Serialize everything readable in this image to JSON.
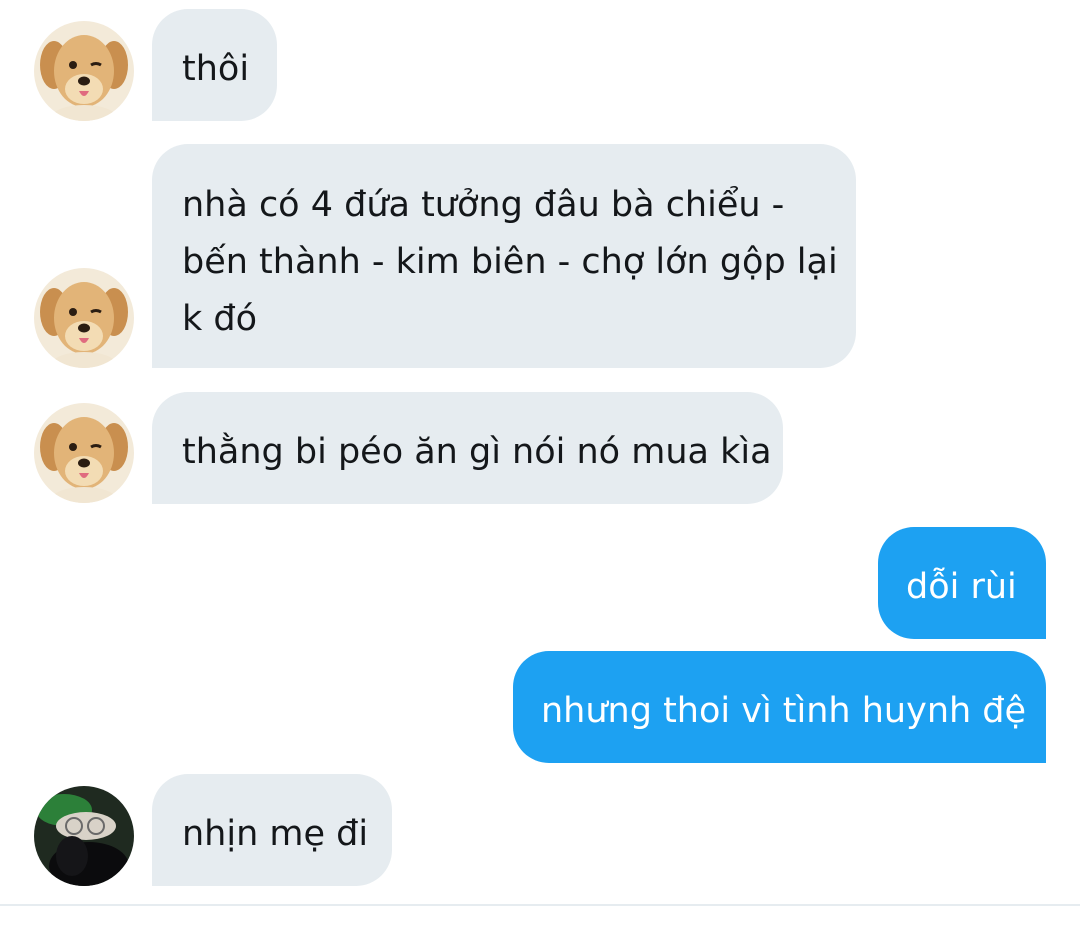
{
  "conversation": {
    "messages": [
      {
        "sender": "contact-puppy",
        "direction": "incoming",
        "text": "thôi"
      },
      {
        "sender": "contact-puppy",
        "direction": "incoming",
        "lines": [
          "nhà có 4 đứa tưởng đâu bà chiểu -",
          "bến thành - kim biên - chợ lớn gộp lại",
          "k đó"
        ]
      },
      {
        "sender": "contact-puppy",
        "direction": "incoming",
        "text": "thằng bi péo ăn gì nói nó mua kìa"
      },
      {
        "sender": "me",
        "direction": "outgoing",
        "text": "dỗi rùi"
      },
      {
        "sender": "me",
        "direction": "outgoing",
        "text": "nhưng thoi vì tình huynh đệ"
      },
      {
        "sender": "contact-dark",
        "direction": "incoming",
        "text": "nhịn mẹ đi"
      }
    ]
  },
  "colors": {
    "incoming_bubble": "#e6ecf0",
    "incoming_text": "#14171a",
    "outgoing_bubble": "#1da1f2",
    "outgoing_text": "#ffffff"
  }
}
